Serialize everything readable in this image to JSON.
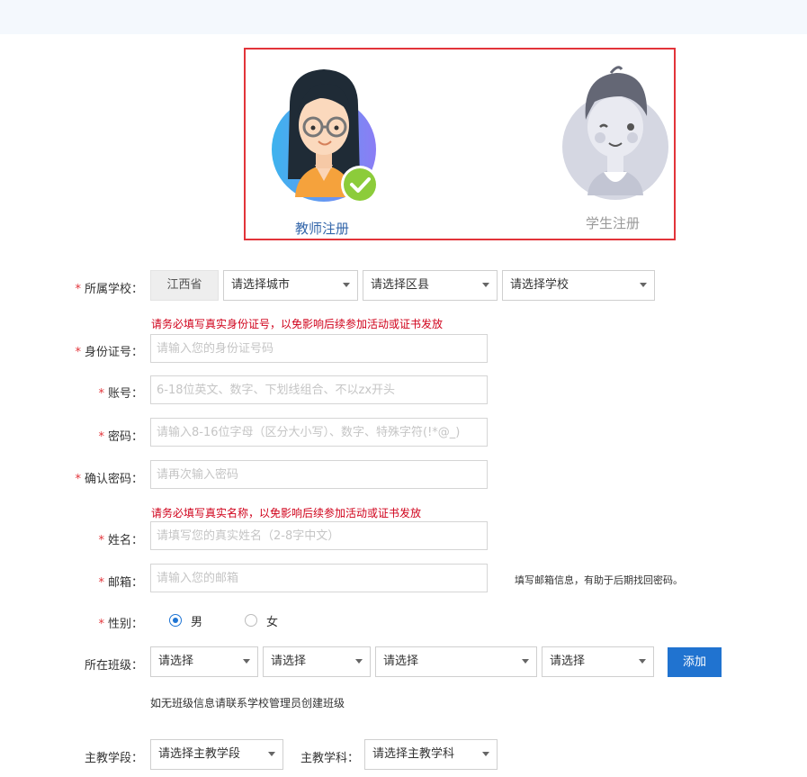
{
  "roles": {
    "teacher": {
      "label": "教师注册",
      "selected": true
    },
    "student": {
      "label": "学生注册",
      "selected": false
    }
  },
  "form": {
    "school": {
      "label": "所属学校：",
      "province": "江西省",
      "city": "请选择城市",
      "district": "请选择区县",
      "school": "请选择学校"
    },
    "id_warning": "请务必填写真实身份证号，以免影响后续参加活动或证书发放",
    "id_number": {
      "label": "身份证号：",
      "placeholder": "请输入您的身份证号码"
    },
    "account": {
      "label": "账号：",
      "placeholder": "6-18位英文、数字、下划线组合、不以zx开头"
    },
    "password": {
      "label": "密码：",
      "placeholder": "请输入8-16位字母（区分大小写）、数字、特殊字符(!*@_)"
    },
    "confirm_password": {
      "label": "确认密码：",
      "placeholder": "请再次输入密码"
    },
    "name_warning": "请务必填写真实名称，以免影响后续参加活动或证书发放",
    "name": {
      "label": "姓名：",
      "placeholder": "请填写您的真实姓名（2-8字中文）"
    },
    "email": {
      "label": "邮箱：",
      "placeholder": "请输入您的邮箱",
      "hint": "填写邮箱信息，有助于后期找回密码。"
    },
    "gender": {
      "label": "性别：",
      "male": "男",
      "female": "女",
      "selected": "male"
    },
    "class": {
      "label": "所在班级：",
      "selects": [
        "请选择",
        "请选择",
        "请选择",
        "请选择"
      ],
      "add_label": "添加",
      "note": "如无班级信息请联系学校管理员创建班级"
    },
    "stage": {
      "label": "主教学段：",
      "value": "请选择主教学段"
    },
    "subject": {
      "label": "主教学科：",
      "value": "请选择主教学科"
    }
  },
  "required_mark": "*",
  "colors": {
    "accent": "#2073d0",
    "warning": "#d0021b",
    "highlight_border": "#e2343a",
    "teacher_label": "#3366aa",
    "student_label": "#999999"
  }
}
